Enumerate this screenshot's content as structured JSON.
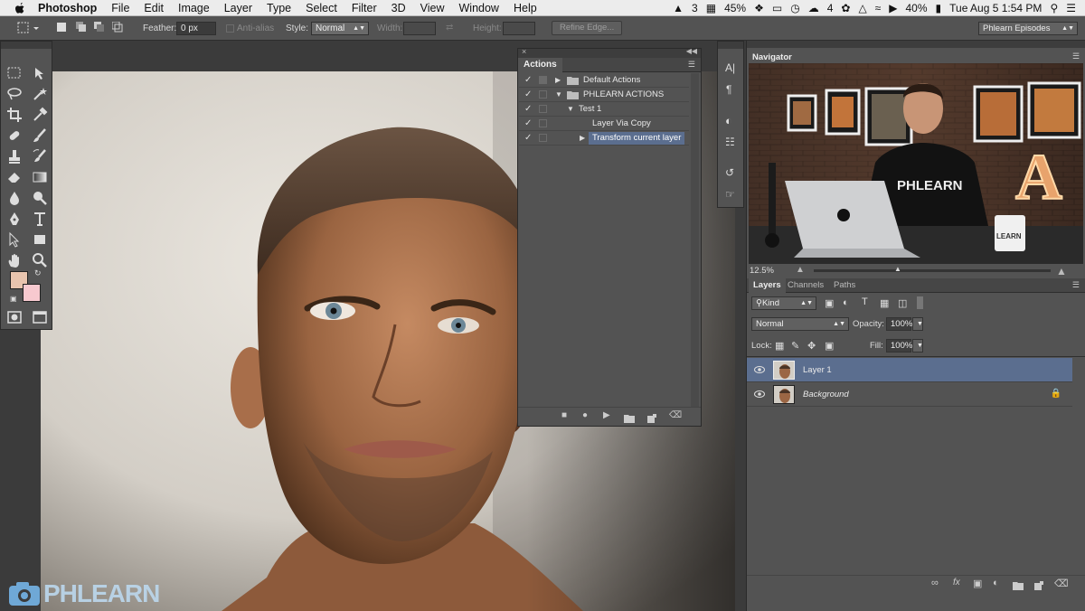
{
  "menubar": {
    "app": "Photoshop",
    "items": [
      "File",
      "Edit",
      "Image",
      "Layer",
      "Type",
      "Select",
      "Filter",
      "3D",
      "View",
      "Window",
      "Help"
    ],
    "status": {
      "adobe_count": "3",
      "battery_small": "45%",
      "cc_count": "4",
      "battery": "40%",
      "datetime": "Tue Aug 5  1:54 PM"
    }
  },
  "options": {
    "feather_label": "Feather:",
    "feather_value": "0 px",
    "antialias_label": "Anti-alias",
    "style_label": "Style:",
    "style_value": "Normal",
    "width_label": "Width:",
    "height_label": "Height:",
    "refine_label": "Refine Edge...",
    "workspace": "Phlearn Episodes"
  },
  "actions": {
    "title": "Actions",
    "rows": [
      {
        "label": "Default Actions",
        "indent": 0,
        "triangle": "right",
        "folder": true
      },
      {
        "label": "PHLEARN ACTIONS",
        "indent": 0,
        "triangle": "down",
        "folder": true
      },
      {
        "label": "Test 1",
        "indent": 1,
        "triangle": "down",
        "folder": false
      },
      {
        "label": "Layer Via Copy",
        "indent": 2,
        "triangle": "",
        "folder": false
      },
      {
        "label": "Transform current layer",
        "indent": 2,
        "triangle": "right",
        "folder": false,
        "selected": true
      }
    ]
  },
  "navigator": {
    "title": "Navigator",
    "zoom": "12.5%",
    "shirt_text": "PHLEARN",
    "mug_text": "LEARN",
    "sign_letter": "A"
  },
  "layers": {
    "tabs": [
      "Layers",
      "Channels",
      "Paths"
    ],
    "kind": "Kind",
    "blend": "Normal",
    "opacity_label": "Opacity:",
    "opacity": "100%",
    "lock_label": "Lock:",
    "fill_label": "Fill:",
    "fill": "100%",
    "items": [
      {
        "name": "Layer 1",
        "selected": true
      },
      {
        "name": "Background",
        "italic": true,
        "locked": true
      }
    ]
  },
  "watermark": "PHLEARN",
  "colors": {
    "foreground": "#e8c4ae",
    "background": "#f7c9cf",
    "selection": "#5b6e8f"
  }
}
